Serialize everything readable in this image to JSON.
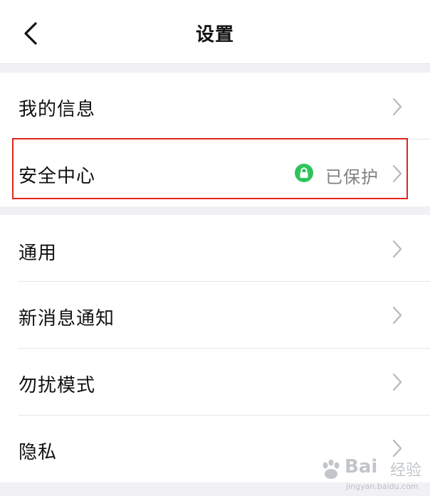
{
  "nav": {
    "title": "设置",
    "back_icon": "chevron-left-icon"
  },
  "items": [
    {
      "label": "我的信息",
      "icon": "chevron-right-icon"
    },
    {
      "label": "安全中心",
      "status": "已保护",
      "status_icon": "lock-icon",
      "status_color": "#2ec45c",
      "highlighted": true,
      "icon": "chevron-right-icon"
    },
    {
      "label": "通用",
      "icon": "chevron-right-icon"
    },
    {
      "label": "新消息通知",
      "icon": "chevron-right-icon"
    },
    {
      "label": "勿扰模式",
      "icon": "chevron-right-icon"
    },
    {
      "label": "隐私",
      "icon": "chevron-right-icon"
    }
  ],
  "colors": {
    "highlight_border": "#e0261b",
    "section_gap": "#f0f0f5",
    "status_green": "#2ec45c"
  },
  "watermark": {
    "brand": "Bai",
    "brand2": "经验",
    "url": "jingyan.baidu.com"
  }
}
